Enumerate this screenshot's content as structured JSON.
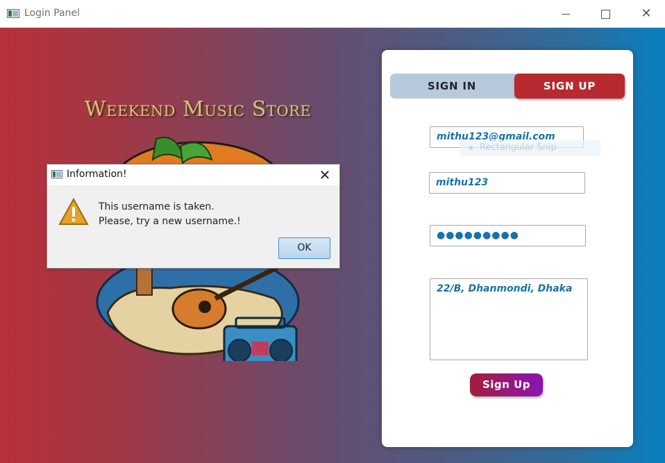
{
  "window": {
    "title": "Login Panel",
    "icon": "app-window-icon"
  },
  "brand": {
    "name": "Weekend Music Store"
  },
  "tabs": {
    "sign_in": "SIGN IN",
    "sign_up": "SIGN UP",
    "active": "sign_up"
  },
  "form": {
    "email": "mithu123@gmail.com",
    "username": "mithu123",
    "password_mask": "●●●●●●●●●",
    "address": "22/B, Dhanmondi, Dhaka",
    "submit_label": "Sign Up"
  },
  "snip_overlay": {
    "label": "Rectangular Snip"
  },
  "dialog": {
    "title": "Information!",
    "message_line1": "This username is taken.",
    "message_line2": "Please, try a new username.!",
    "ok_label": "OK",
    "icon": "warning-icon"
  },
  "colors": {
    "accent_red": "#b82a30",
    "tab_bg": "#b9c9dc",
    "field_text": "#1a73a8",
    "gradient_left": "#b7303a",
    "gradient_right": "#0a7fc0",
    "brand_gold": "#d7c277"
  }
}
